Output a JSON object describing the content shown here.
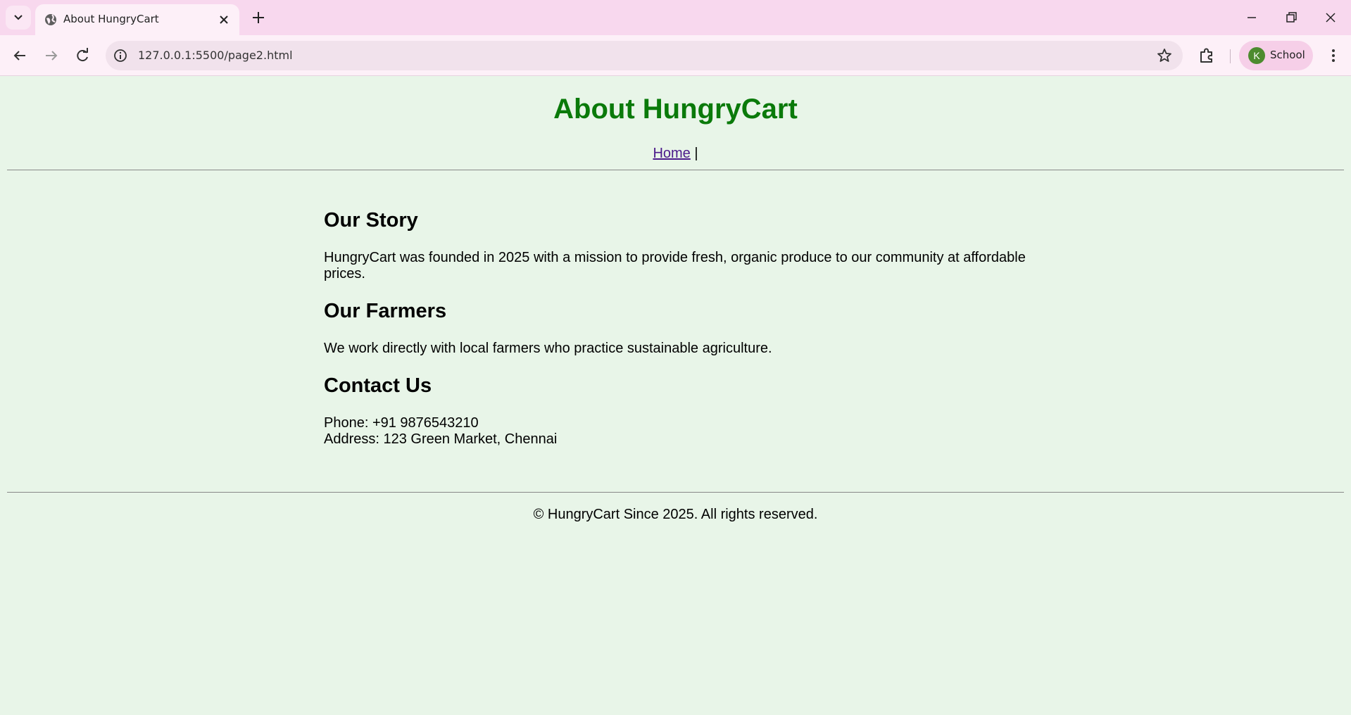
{
  "browser": {
    "tab_title": "About HungryCart",
    "url": "127.0.0.1:5500/page2.html",
    "profile_initial": "K",
    "profile_label": "School"
  },
  "page": {
    "title": "About HungryCart",
    "nav": {
      "home_label": "Home",
      "separator": " |"
    },
    "sections": [
      {
        "heading": "Our Story",
        "text": "HungryCart was founded in 2025 with a mission to provide fresh, organic produce to our community at affordable prices."
      },
      {
        "heading": "Our Farmers",
        "text": "We work directly with local farmers who practice sustainable agriculture."
      },
      {
        "heading": "Contact Us",
        "phone": "Phone: +91 9876543210",
        "address": "Address: 123 Green Market, Chennai"
      }
    ],
    "footer": "© HungryCart Since 2025. All rights reserved."
  },
  "colors": {
    "page_background": "#e8f5e8",
    "title_green": "#0a7a0a",
    "link_visited": "#4b1a8a",
    "tabbar": "#f8d8ee"
  }
}
